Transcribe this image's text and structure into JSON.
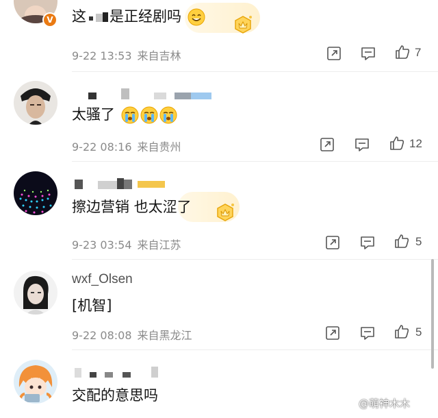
{
  "comments": [
    {
      "username": "",
      "text": "这",
      "text_mid": "是正经剧吗",
      "emojis": [
        "smile-emoji"
      ],
      "date": "9-22 13:53",
      "location": "来自吉林",
      "likes": "7",
      "verified_badge": "V"
    },
    {
      "username": "",
      "text": "太骚了",
      "emojis": [
        "crying-emoji",
        "crying-emoji",
        "crying-emoji"
      ],
      "date": "9-22 08:16",
      "location": "来自贵州",
      "likes": "12"
    },
    {
      "username": "",
      "text": "擦边营销 也太涩了",
      "date": "9-23 03:54",
      "location": "来自江苏",
      "likes": "5"
    },
    {
      "username": "wxf_Olsen",
      "text": "[机智]",
      "date": "9-22 08:08",
      "location": "来自黑龙江",
      "likes": "5"
    },
    {
      "username": "",
      "text": "交配的意思吗"
    }
  ],
  "watermark": "@萌神木木",
  "colors": {
    "meta_text": "#8a8a8a",
    "badge_orange": "#ea7a13",
    "gold_bubble": "#fff1cf"
  }
}
